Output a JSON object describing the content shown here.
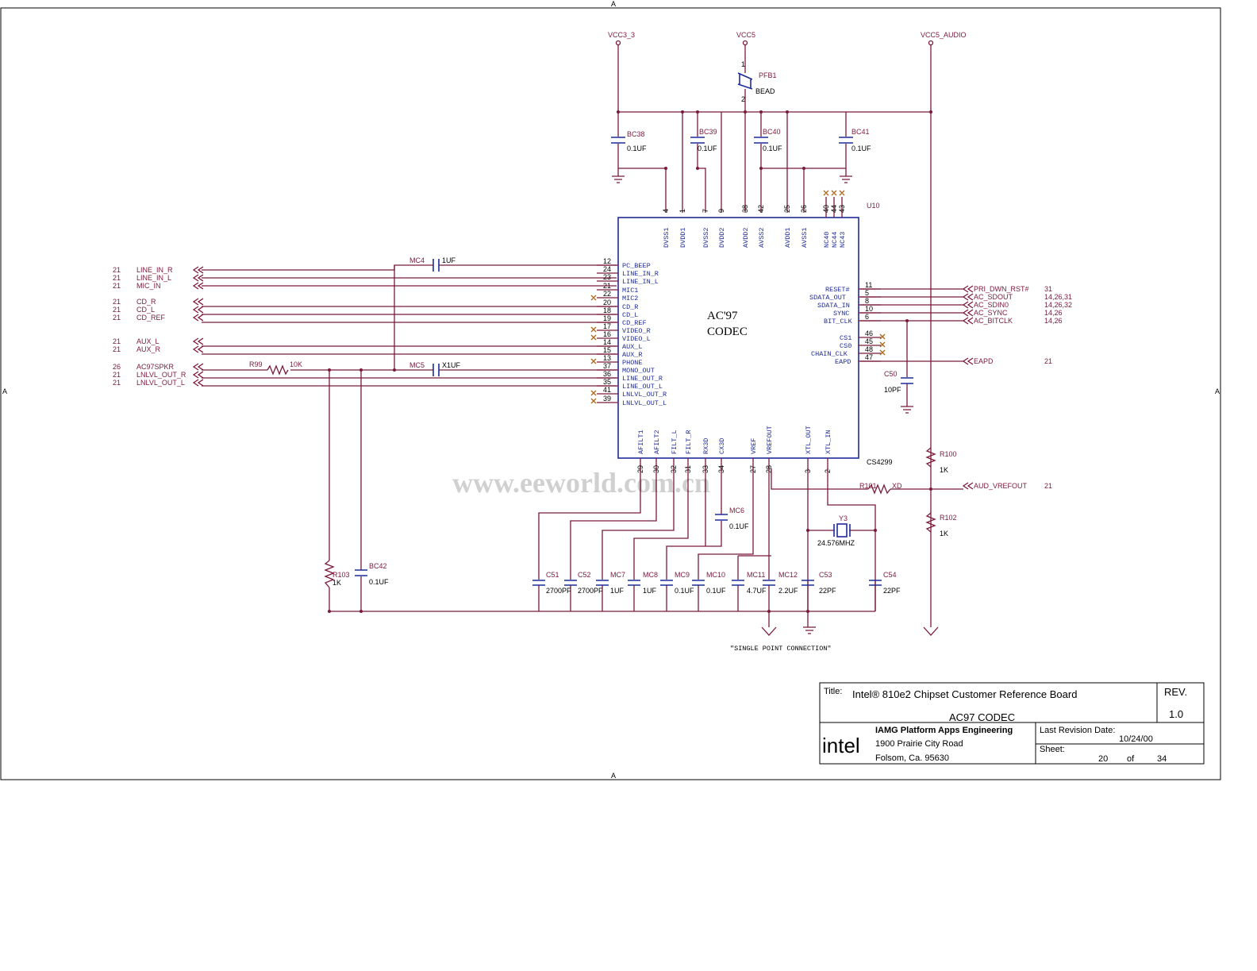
{
  "rails": {
    "vcc3": "VCC3_3",
    "vcc5": "VCC5",
    "vcc5a": "VCC5_AUDIO"
  },
  "bead": {
    "ref": "PFB1",
    "value": "BEAD",
    "pin1": "1",
    "pin2": "2"
  },
  "chip": {
    "ref": "U10",
    "part": "CS4299",
    "name1": "AC'97",
    "name2": "CODEC",
    "top_pins": [
      {
        "num": "4",
        "name": "DVSS1"
      },
      {
        "num": "1",
        "name": "DVDD1"
      },
      {
        "num": "7",
        "name": "DVSS2"
      },
      {
        "num": "9",
        "name": "DVDD2"
      },
      {
        "num": "38",
        "name": "AVDD2"
      },
      {
        "num": "42",
        "name": "AVSS2"
      },
      {
        "num": "25",
        "name": "AVDD1"
      },
      {
        "num": "26",
        "name": "AVSS1"
      },
      {
        "num": "40",
        "name": "NC40"
      },
      {
        "num": "44",
        "name": "NC44"
      },
      {
        "num": "43",
        "name": "NC43"
      }
    ],
    "left_pins": [
      {
        "num": "12",
        "name": "PC_BEEP"
      },
      {
        "num": "24",
        "name": "LINE_IN_R"
      },
      {
        "num": "23",
        "name": "LINE_IN_L"
      },
      {
        "num": "21",
        "name": "MIC1"
      },
      {
        "num": "22",
        "name": "MIC2"
      },
      {
        "num": "20",
        "name": "CD_R"
      },
      {
        "num": "18",
        "name": "CD_L"
      },
      {
        "num": "19",
        "name": "CD_REF"
      },
      {
        "num": "17",
        "name": "VIDEO_R"
      },
      {
        "num": "16",
        "name": "VIDEO_L"
      },
      {
        "num": "14",
        "name": "AUX_L"
      },
      {
        "num": "15",
        "name": "AUX_R"
      },
      {
        "num": "13",
        "name": "PHONE"
      },
      {
        "num": "37",
        "name": "MONO_OUT"
      },
      {
        "num": "36",
        "name": "LINE_OUT_R"
      },
      {
        "num": "35",
        "name": "LINE_OUT_L"
      },
      {
        "num": "41",
        "name": "LNLVL_OUT_R"
      },
      {
        "num": "39",
        "name": "LNLVL_OUT_L"
      }
    ],
    "right_pins": [
      {
        "num": "11",
        "name": "RESET#"
      },
      {
        "num": "5",
        "name": "SDATA_OUT"
      },
      {
        "num": "8",
        "name": "SDATA_IN"
      },
      {
        "num": "10",
        "name": "SYNC"
      },
      {
        "num": "6",
        "name": "BIT_CLK"
      },
      {
        "num": "46",
        "name": "CS1"
      },
      {
        "num": "45",
        "name": "CS0"
      },
      {
        "num": "48",
        "name": "CHAIN_CLK"
      },
      {
        "num": "47",
        "name": "EAPD"
      }
    ],
    "bottom_pins": [
      {
        "num": "29",
        "name": "AFILT1"
      },
      {
        "num": "30",
        "name": "AFILT2"
      },
      {
        "num": "32",
        "name": "FILT_L"
      },
      {
        "num": "31",
        "name": "FILT_R"
      },
      {
        "num": "33",
        "name": "RX3D"
      },
      {
        "num": "34",
        "name": "CX3D"
      },
      {
        "num": "27",
        "name": "VREF"
      },
      {
        "num": "28",
        "name": "VREFOUT"
      },
      {
        "num": "3",
        "name": "XTL_OUT"
      },
      {
        "num": "2",
        "name": "XTL_IN"
      }
    ]
  },
  "left_ports": [
    {
      "sheet": "21",
      "name": "LINE_IN_R"
    },
    {
      "sheet": "21",
      "name": "LINE_IN_L"
    },
    {
      "sheet": "21",
      "name": "MIC_IN"
    },
    {
      "sheet": "21",
      "name": "CD_R"
    },
    {
      "sheet": "21",
      "name": "CD_L"
    },
    {
      "sheet": "21",
      "name": "CD_REF"
    },
    {
      "sheet": "21",
      "name": "AUX_L"
    },
    {
      "sheet": "21",
      "name": "AUX_R"
    },
    {
      "sheet": "26",
      "name": "AC97SPKR"
    },
    {
      "sheet": "21",
      "name": "LNLVL_OUT_R"
    },
    {
      "sheet": "21",
      "name": "LNLVL_OUT_L"
    }
  ],
  "right_ports": [
    {
      "name": "PRI_DWN_RST#",
      "sheet": "31"
    },
    {
      "name": "AC_SDOUT",
      "sheet": "14,26,31"
    },
    {
      "name": "AC_SDIN0",
      "sheet": "14,26,32"
    },
    {
      "name": "AC_SYNC",
      "sheet": "14,26"
    },
    {
      "name": "AC_BITCLK",
      "sheet": "14,26"
    },
    {
      "name": "EAPD",
      "sheet": "21"
    },
    {
      "name": "AUD_VREFOUT",
      "sheet": "21"
    }
  ],
  "parts": {
    "bc38": {
      "ref": "BC38",
      "val": "0.1UF"
    },
    "bc39": {
      "ref": "BC39",
      "val": "0.1UF"
    },
    "bc40": {
      "ref": "BC40",
      "val": "0.1UF"
    },
    "bc41": {
      "ref": "BC41",
      "val": "0.1UF"
    },
    "mc4": {
      "ref": "MC4",
      "val": "1UF"
    },
    "mc5": {
      "ref": "MC5",
      "val": "X1UF"
    },
    "r99": {
      "ref": "R99",
      "val": "10K"
    },
    "r103": {
      "ref": "R103",
      "val": "1K"
    },
    "bc42": {
      "ref": "BC42",
      "val": "0.1UF"
    },
    "c50": {
      "ref": "C50",
      "val": "10PF"
    },
    "r100": {
      "ref": "R100",
      "val": "1K"
    },
    "r101": {
      "ref": "R101",
      "val": "XD"
    },
    "r102": {
      "ref": "R102",
      "val": "1K"
    },
    "y3": {
      "ref": "Y3",
      "val": "24.576MHZ"
    },
    "mc6": {
      "ref": "MC6",
      "val": "0.1UF"
    },
    "c51": {
      "ref": "C51",
      "val": "2700PF"
    },
    "c52": {
      "ref": "C52",
      "val": "2700PF"
    },
    "mc7": {
      "ref": "MC7",
      "val": "1UF"
    },
    "mc8": {
      "ref": "MC8",
      "val": "1UF"
    },
    "mc9": {
      "ref": "MC9",
      "val": "0.1UF"
    },
    "mc10": {
      "ref": "MC10",
      "val": "0.1UF"
    },
    "mc11": {
      "ref": "MC11",
      "val": "4.7UF"
    },
    "mc12": {
      "ref": "MC12",
      "val": "2.2UF"
    },
    "c53": {
      "ref": "C53",
      "val": "22PF"
    },
    "c54": {
      "ref": "C54",
      "val": "22PF"
    }
  },
  "note": "\"SINGLE POINT CONNECTION\"",
  "watermark": "www.eeworld.com.cn",
  "border_mark": "A",
  "title_block": {
    "title_label": "Title:",
    "title": "Intel® 810e2 Chipset Customer Reference Board",
    "subtitle": "AC97 CODEC",
    "rev_label": "REV.",
    "rev": "1.0",
    "logo": "intel",
    "org": "IAMG Platform Apps Engineering",
    "addr1": "1900 Prairie City Road",
    "addr2": "Folsom, Ca. 95630",
    "lrd_label": "Last Revision Date:",
    "lrd": "10/24/00",
    "sheet_label": "Sheet:",
    "sheet": "20",
    "of": "of",
    "total": "34"
  }
}
